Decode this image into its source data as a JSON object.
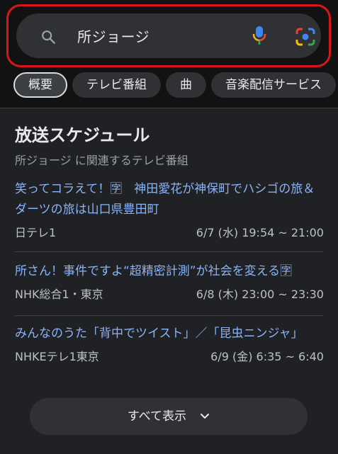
{
  "search": {
    "query": "所ジョージ"
  },
  "chips": [
    "概要",
    "テレビ番組",
    "曲",
    "音楽配信サービス"
  ],
  "card": {
    "title": "放送スケジュール",
    "subtitle": "所ジョージ に関連するテレビ番組",
    "items": [
      {
        "title": "笑ってコラえて！🈑　神田愛花が神保町でハシゴの旅＆ダーツの旅は山口県豊田町",
        "channel": "日テレ1",
        "time": "6/7 (水) 19:54 ~ 21:00"
      },
      {
        "title": "所さん！事件ですよ“超精密計測”が社会を変える🈑",
        "channel": "NHK総合1・東京",
        "time": "6/8 (木) 23:00 ~ 23:30"
      },
      {
        "title": "みんなのうた「背中でツイスト」／「昆虫ニンジャ」",
        "channel": "NHKEテレ1東京",
        "time": "6/9 (金) 6:35 ~ 6:40"
      }
    ],
    "show_all_label": "すべて表示"
  },
  "colors": {
    "link": "#8ab4f8",
    "highlight_border": "#d6181b",
    "background": "#121212",
    "card": "#202124"
  }
}
